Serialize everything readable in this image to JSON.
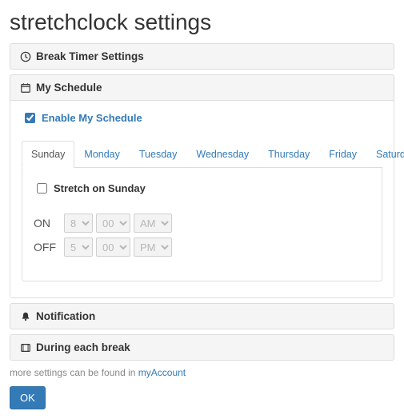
{
  "title": "stretchclock settings",
  "panels": {
    "break_timer": {
      "label": "Break Timer Settings"
    },
    "schedule": {
      "label": "My Schedule",
      "enable_label": "Enable My Schedule",
      "enable_checked": true,
      "tabs": [
        "Sunday",
        "Monday",
        "Tuesday",
        "Wednesday",
        "Thursday",
        "Friday",
        "Saturday"
      ],
      "active_tab": "Sunday",
      "stretch_label": "Stretch on Sunday",
      "stretch_checked": false,
      "on_label": "ON",
      "off_label": "OFF",
      "on": {
        "hour": "8",
        "minute": "00",
        "ampm": "AM"
      },
      "off": {
        "hour": "5",
        "minute": "00",
        "ampm": "PM"
      }
    },
    "notification": {
      "label": "Notification"
    },
    "during_break": {
      "label": "During each break"
    }
  },
  "footer": {
    "text_prefix": "more settings can be found in ",
    "link_label": "myAccount"
  },
  "ok_label": "OK"
}
